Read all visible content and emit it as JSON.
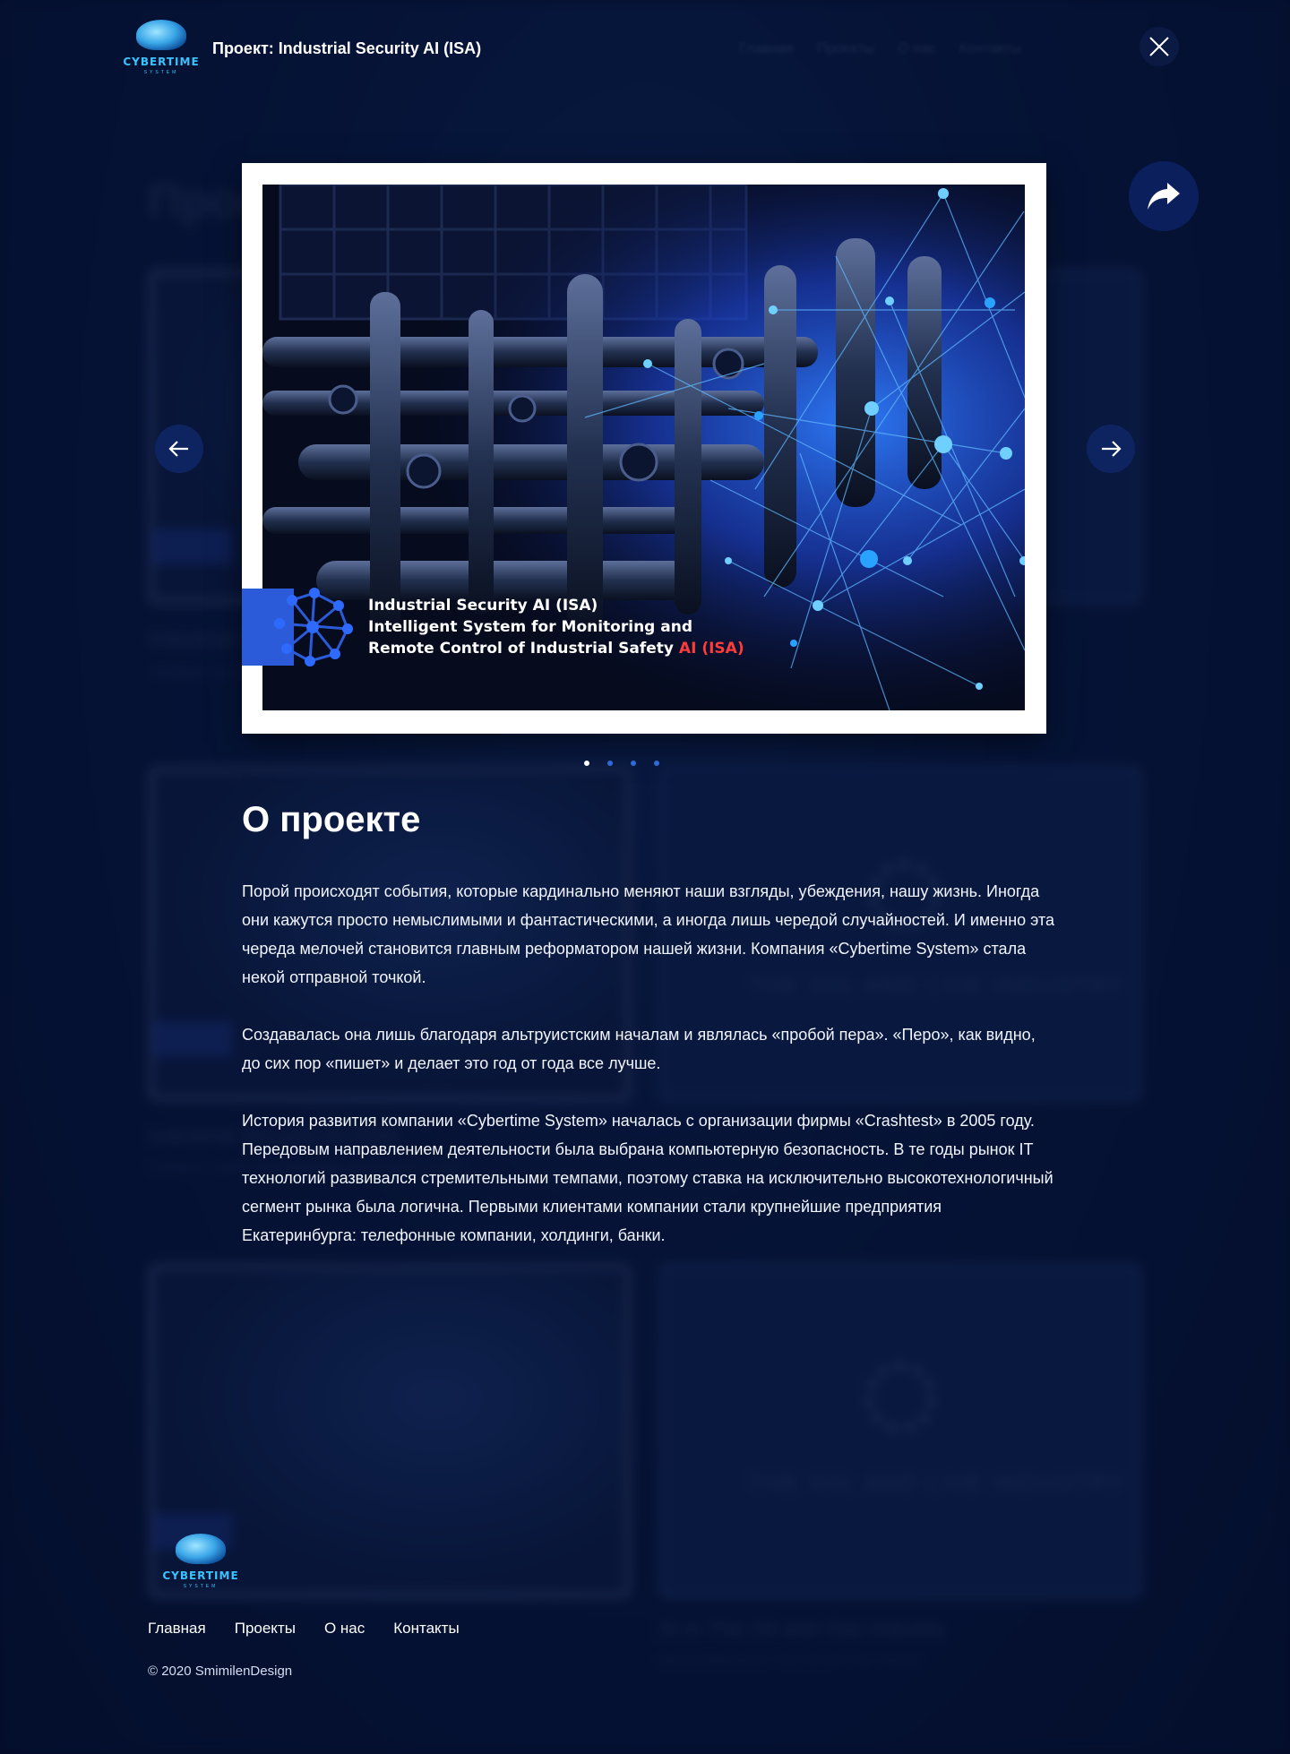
{
  "header": {
    "logo_wordmark": "CYBERTIME",
    "logo_sub": "SYSTEM",
    "modal_title": "Проект: Industrial Security AI (ISA)",
    "nav_items": [
      "Главная",
      "Проекты",
      "О нас",
      "Контакты"
    ]
  },
  "background_page": {
    "title": "Проекты",
    "cards": [
      {
        "title": "Industrial Security AI (ISA)",
        "sub": "Intelligent System for Monitoring and Remote Control"
      },
      {
        "title": "Industrial Security AI (ISA)",
        "sub": "Intelligent System for Monitoring and Remote Control"
      },
      {
        "title": "",
        "sub": ""
      },
      {
        "title": "AI in The Oil and Gas Industry",
        "sub": "Neural Networks in The Oil and Gas Industry"
      }
    ],
    "ring_text": "THE XXL AND LIVE INDUSTRY"
  },
  "slider": {
    "caption_line1": "Industrial Security AI (ISA)",
    "caption_line2": "Intelligent System for Monitoring and",
    "caption_line3": "Remote Control of Industrial Safety",
    "caption_accent": "AI (ISA)",
    "prev_icon": "arrow-left-icon",
    "next_icon": "arrow-right-icon",
    "slide_count": 4,
    "active_slide": 1
  },
  "about": {
    "heading": "О проекте",
    "paragraphs": [
      "Порой происходят события, которые кардинально меняют наши взгляды, убеждения, нашу жизнь. Иногда они кажутся просто немыслимыми и фантастическими, а иногда лишь чередой случайностей. И именно эта череда мелочей становится главным реформатором нашей жизни. Компания «Cybertime System» стала некой отправной точкой.",
      "Создавалась она лишь благодаря альтруистским началам и являлась «пробой пера». «Перо», как видно, до сих пор «пишет» и делает это год от года все лучше.",
      "История развития компании «Cybertime System» началась с организации фирмы «Crashtest» в 2005 году. Передовым направлением деятельности была выбрана компьютерную безопасность. В те годы рынок IT технологий развивался стремительными темпами, поэтому ставка на исключительно высокотехнологичный сегмент рынка была логична. Первыми клиентами компании стали крупнейшие предприятия Екатеринбурга: телефонные компании, холдинги, банки."
    ]
  },
  "footer": {
    "logo_wordmark": "CYBERTIME",
    "logo_sub": "SYSTEM",
    "nav": [
      "Главная",
      "Проекты",
      "О нас",
      "Контакты"
    ],
    "copyright": "© 2020 SmimilenDesign"
  },
  "colors": {
    "background": "#061230",
    "accent_blue": "#2c5bd9",
    "accent_red": "#ff3b3b",
    "logo_cyan": "#39c4ff"
  }
}
